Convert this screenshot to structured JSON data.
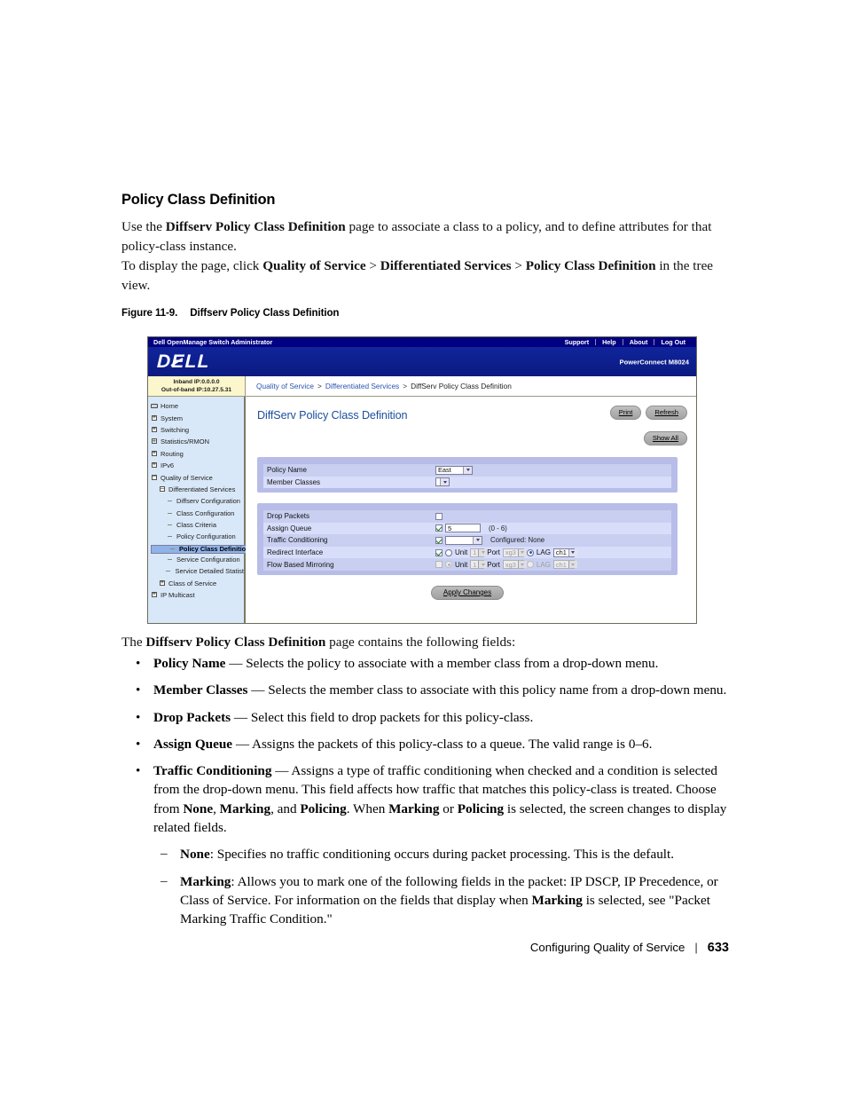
{
  "doc": {
    "heading": "Policy Class Definition",
    "para1_pre": "Use the ",
    "para1_bold": "Diffserv Policy Class Definition",
    "para1_post": " page to associate a class to a policy, and to define attributes for that policy-class instance.",
    "para2_pre": "To display the page, click ",
    "para2_b1": "Quality of Service",
    "para2_gt1": " > ",
    "para2_b2": "Differentiated Services",
    "para2_gt2": " > ",
    "para2_b3": "Policy Class Definition",
    "para2_post": " in the tree view.",
    "figure_number": "Figure 11-9.",
    "figure_title": "Diffserv Policy Class Definition",
    "para3_pre": "The ",
    "para3_bold": "Diffserv Policy Class Definition",
    "para3_post": " page contains the following fields:"
  },
  "bullets": [
    {
      "term": "Policy Name",
      "desc": " — Selects the policy to associate with a member class from a drop-down menu."
    },
    {
      "term": "Member Classes",
      "desc": " — Selects the member class to associate with this policy name from a drop-down menu."
    },
    {
      "term": "Drop Packets",
      "desc": " — Select this field to drop packets for this policy-class."
    },
    {
      "term": "Assign Queue",
      "desc": " — Assigns the packets of this policy-class to a queue. The valid range is 0–6."
    },
    {
      "term": "Traffic Conditioning",
      "desc_a": " — Assigns a type of traffic conditioning when checked and a condition is selected from the drop-down menu. This field affects how traffic that matches this policy-class is treated. Choose from ",
      "b_none": "None",
      "sep1": ", ",
      "b_marking": "Marking",
      "sep2": ", and ",
      "b_policing": "Policing",
      "desc_b": ". When ",
      "b_marking2": "Marking",
      "desc_c": " or ",
      "b_policing2": "Policing",
      "desc_d": " is selected, the screen changes to display related fields."
    }
  ],
  "sub_bullets": [
    {
      "term": "None",
      "desc": ": Specifies no traffic conditioning occurs during packet processing. This is the default."
    },
    {
      "term": "Marking",
      "desc_a": ": Allows you to mark one of the following fields in the packet: IP DSCP, IP Precedence, or Class of Service. For information on the fields that display when ",
      "term_b": "Marking",
      "desc_b": " is selected, see \"Packet Marking Traffic Condition.\""
    }
  ],
  "footer": {
    "chapter": "Configuring Quality of Service",
    "separator": "|",
    "page_number": "633"
  },
  "app": {
    "title_bar": "Dell OpenManage Switch Administrator",
    "top_links": [
      "Support",
      "Help",
      "About",
      "Log Out"
    ],
    "brand": "DELL",
    "model": "PowerConnect M8024",
    "inband_ip": "Inband IP:0.0.0.0",
    "oob_ip": "Out-of-band IP:10.27.5.31",
    "breadcrumb": [
      "Quality of Service",
      "Differentiated Services",
      "DiffServ Policy Class Definition"
    ],
    "breadcrumb_sep": ">"
  },
  "tree": [
    {
      "label": "Home",
      "level": 0,
      "glyph": "home",
      "selected": false
    },
    {
      "label": "System",
      "level": 0,
      "glyph": "plus",
      "selected": false
    },
    {
      "label": "Switching",
      "level": 0,
      "glyph": "plus",
      "selected": false
    },
    {
      "label": "Statistics/RMON",
      "level": 0,
      "glyph": "plus",
      "selected": false
    },
    {
      "label": "Routing",
      "level": 0,
      "glyph": "plus",
      "selected": false
    },
    {
      "label": "IPv6",
      "level": 0,
      "glyph": "plus",
      "selected": false
    },
    {
      "label": "Quality of Service",
      "level": 0,
      "glyph": "minus",
      "selected": false
    },
    {
      "label": "Differentiated Services",
      "level": 1,
      "glyph": "minus",
      "selected": false
    },
    {
      "label": "Diffserv Configuration",
      "level": 2,
      "glyph": "dash",
      "selected": false
    },
    {
      "label": "Class Configuration",
      "level": 2,
      "glyph": "dash",
      "selected": false
    },
    {
      "label": "Class Criteria",
      "level": 2,
      "glyph": "dash",
      "selected": false
    },
    {
      "label": "Policy Configuration",
      "level": 2,
      "glyph": "dash",
      "selected": false
    },
    {
      "label": "Policy Class Definition",
      "level": 2,
      "glyph": "dash",
      "selected": true
    },
    {
      "label": "Service Configuration",
      "level": 2,
      "glyph": "dash",
      "selected": false
    },
    {
      "label": "Service Detailed Statist",
      "level": 2,
      "glyph": "dash",
      "selected": false
    },
    {
      "label": "Class of Service",
      "level": 1,
      "glyph": "plus",
      "selected": false
    },
    {
      "label": "IP Multicast",
      "level": 0,
      "glyph": "plus",
      "selected": false
    }
  ],
  "page": {
    "title": "DiffServ Policy Class Definition",
    "buttons": {
      "print": "Print",
      "refresh": "Refresh",
      "show_all": "Show All",
      "apply": "Apply Changes"
    },
    "panel_top": [
      {
        "label": "Policy Name",
        "value": "East"
      },
      {
        "label": "Member Classes",
        "value": ""
      }
    ],
    "panel_bottom": {
      "drop_packets": {
        "label": "Drop Packets",
        "checked": false
      },
      "assign_queue": {
        "label": "Assign Queue",
        "checked": true,
        "value": "5",
        "range": "(0 - 6)"
      },
      "traffic_cond": {
        "label": "Traffic Conditioning",
        "checked": true,
        "value": "",
        "configured": "Configured: None"
      },
      "redirect_if": {
        "label": "Redirect Interface",
        "checked": true,
        "unit_label": "Unit",
        "unit_value": "1",
        "unit_selected": false,
        "port_label": "Port",
        "port_value": "xg3",
        "lag_label": "LAG",
        "lag_value": "ch1",
        "lag_selected": true
      },
      "flow_mirror": {
        "label": "Flow Based Mirroring",
        "checked": false,
        "unit_label": "Unit",
        "unit_value": "1",
        "unit_selected": true,
        "port_label": "Port",
        "port_value": "xg3",
        "lag_label": "LAG",
        "lag_value": "ch1",
        "lag_selected": false
      }
    }
  },
  "colors": {
    "dell_blue": "#0d1f8d",
    "navy_bar": "#000080",
    "panel_violet": "#b7bde8",
    "row_odd": "#c8cff0",
    "row_even": "#d8defa",
    "tree_bg": "#d9e8f8",
    "tree_selected": "#8fb3e8",
    "ip_box": "#fbf6cc",
    "title_link": "#1b4f9c"
  }
}
